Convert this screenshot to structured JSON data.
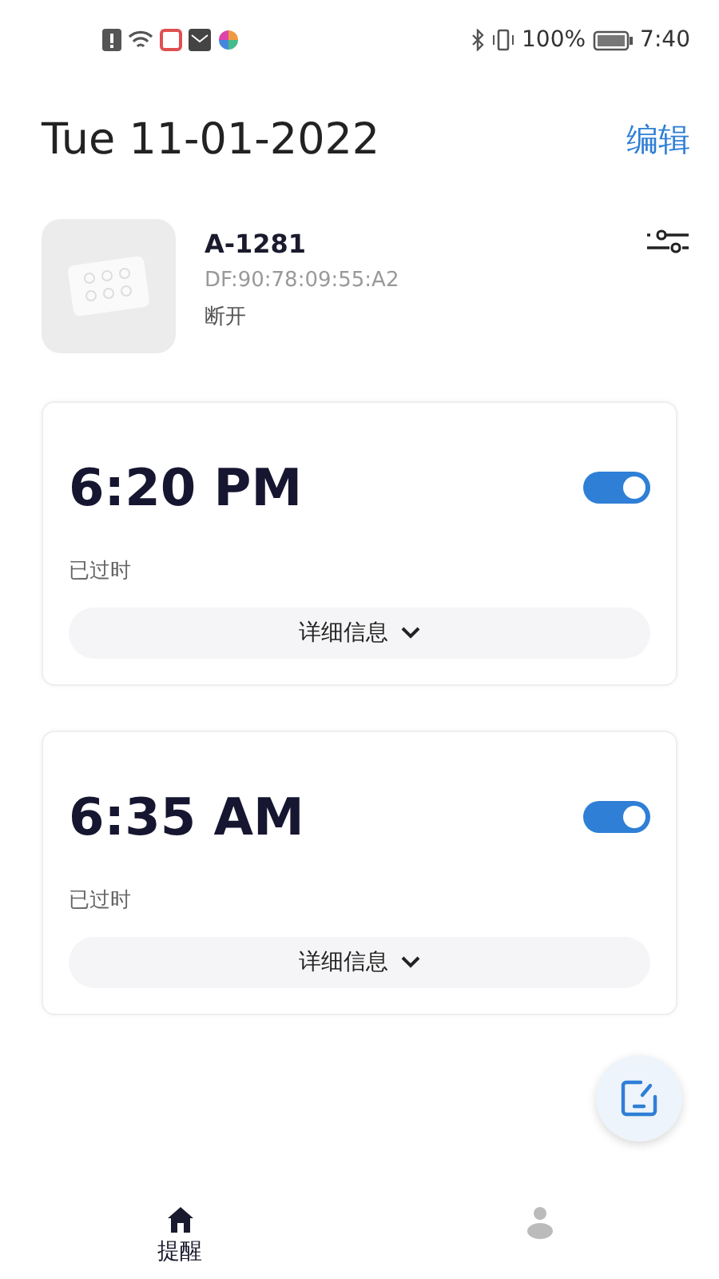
{
  "status_bar": {
    "battery": "100%",
    "time": "7:40"
  },
  "header": {
    "date": "Tue 11-01-2022",
    "edit": "编辑"
  },
  "device": {
    "name": "A-1281",
    "address": "DF:90:78:09:55:A2",
    "status": "断开"
  },
  "alarms": [
    {
      "time": "6:20 PM",
      "status": "已过时",
      "on": true,
      "details": "详细信息"
    },
    {
      "time": "6:35 AM",
      "status": "已过时",
      "on": true,
      "details": "详细信息"
    }
  ],
  "tabs": [
    {
      "label": "提醒",
      "kind": "home",
      "selected": true
    },
    {
      "kind": "profile",
      "selected": false
    }
  ]
}
